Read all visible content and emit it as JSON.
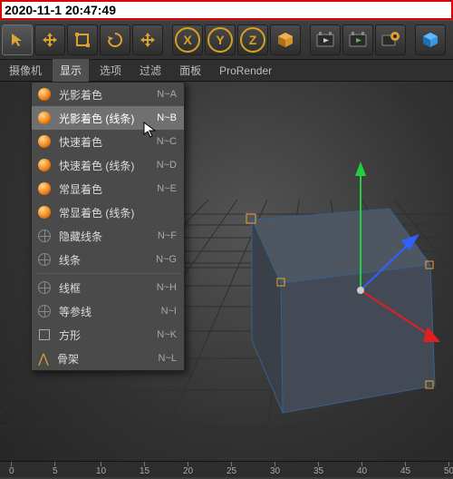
{
  "timestamp": "2020-11-1 20:47:49",
  "toolbar": {
    "icons": [
      "cursor",
      "move",
      "scale",
      "rotate",
      "magnet",
      "recent"
    ],
    "axes": [
      "X",
      "Y",
      "Z"
    ]
  },
  "secondary_tabs": {
    "camera": "摄像机",
    "display": "显示",
    "options": "选项",
    "filter": "过滤",
    "panel": "面板",
    "prorender": "ProRender"
  },
  "dropdown": {
    "items": [
      {
        "label": "光影着色",
        "shortcut": "N~A",
        "icon": "sphere"
      },
      {
        "label": "光影着色 (线条)",
        "shortcut": "N~B",
        "icon": "sphere",
        "hover": true
      },
      {
        "label": "快速着色",
        "shortcut": "N~C",
        "icon": "sphere"
      },
      {
        "label": "快速着色 (线条)",
        "shortcut": "N~D",
        "icon": "sphere"
      },
      {
        "label": "常显着色",
        "shortcut": "N~E",
        "icon": "sphere"
      },
      {
        "label": "常显着色 (线条)",
        "shortcut": "",
        "icon": "sphere"
      },
      {
        "label": "隐藏线条",
        "shortcut": "N~F",
        "icon": "wire"
      },
      {
        "label": "线条",
        "shortcut": "N~G",
        "icon": "wire"
      },
      {
        "sep": true
      },
      {
        "label": "线框",
        "shortcut": "N~H",
        "icon": "wire"
      },
      {
        "label": "等参线",
        "shortcut": "N~I",
        "icon": "wire"
      },
      {
        "label": "方形",
        "shortcut": "N~K",
        "icon": "square"
      },
      {
        "label": "骨架",
        "shortcut": "N~L",
        "icon": "bones"
      }
    ]
  },
  "timeline": {
    "ticks": [
      "0",
      "5",
      "10",
      "15",
      "20",
      "25",
      "30",
      "35",
      "40",
      "45",
      "50"
    ]
  }
}
